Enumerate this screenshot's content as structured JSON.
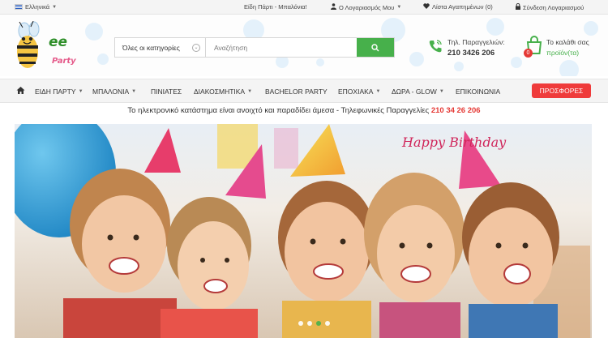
{
  "topbar": {
    "language": "Ελληνικά",
    "link_party": "Είδη Πάρτι - Μπαλόνια!",
    "account": "Ο Λογαριασμός Μου",
    "wishlist": "Λίστα Αγαπημένων (0)",
    "login": "Σύνδεση Λογαριασμού"
  },
  "logo": {
    "text_top": "ee",
    "text_bottom": "Party"
  },
  "search": {
    "category": "Όλες οι κατηγορίες",
    "placeholder": "Αναζήτηση"
  },
  "contact": {
    "label": "Τηλ. Παραγγελιών:",
    "phone": "210 3426 206"
  },
  "cart": {
    "title": "Το καλάθι σας",
    "subtitle": "προϊόν(τα)",
    "count": "0"
  },
  "nav": {
    "items": [
      {
        "label": "ΕΙΔΗ ΠΑΡΤΥ",
        "dropdown": true
      },
      {
        "label": "ΜΠΑΛΟΝΙΑ",
        "dropdown": true
      },
      {
        "label": "ΠΙΝΙΑΤΕΣ",
        "dropdown": false
      },
      {
        "label": "ΔΙΑΚΟΣΜΗΤΙΚΑ",
        "dropdown": true
      },
      {
        "label": "BACHELOR PARTY",
        "dropdown": false
      },
      {
        "label": "ΕΠΟΧΙΑΚΑ",
        "dropdown": true
      },
      {
        "label": "ΔΩΡΑ - GLOW",
        "dropdown": true
      },
      {
        "label": "ΕΠΙΚΟΙΝΩΝΙΑ",
        "dropdown": false
      }
    ],
    "offers": "ΠΡΟΣΦΟΡΕΣ"
  },
  "notice": {
    "text": "Το ηλεκτρονικό κατάστημα είναι ανοιχτό και παραδίδει άμεσα - Τηλεφωνικές Παραγγελίες",
    "phone": "210 34 26 206"
  },
  "banner": {
    "slides_count": 4,
    "active_slide": 3,
    "cake_text": "Happy Birthday"
  },
  "colors": {
    "accent_green": "#47b04b",
    "offers_red": "#ef3b3b",
    "phone_red": "#e53935"
  }
}
